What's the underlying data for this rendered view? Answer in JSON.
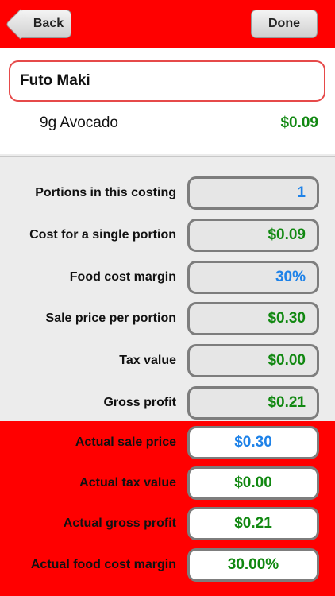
{
  "navbar": {
    "back_label": "Back",
    "done_label": "Done"
  },
  "recipe": {
    "name": "Futo Maki",
    "ingredient": {
      "label": "9g Avocado",
      "cost": "$0.09"
    }
  },
  "calculations": [
    {
      "label": "Portions in this costing",
      "value": "1",
      "color": "#1e82e8"
    },
    {
      "label": "Cost for a single portion",
      "value": "$0.09",
      "color": "#118811"
    },
    {
      "label": "Food cost margin",
      "value": "30%",
      "color": "#1e82e8"
    },
    {
      "label": "Sale price per portion",
      "value": "$0.30",
      "color": "#118811"
    },
    {
      "label": "Tax value",
      "value": "$0.00",
      "color": "#118811"
    },
    {
      "label": "Gross profit",
      "value": "$0.21",
      "color": "#118811"
    }
  ],
  "actuals": [
    {
      "label": "Actual sale price",
      "value": "$0.30",
      "color": "#1e82e8"
    },
    {
      "label": "Actual tax value",
      "value": "$0.00",
      "color": "#118811"
    },
    {
      "label": "Actual gross profit",
      "value": "$0.21",
      "color": "#118811"
    },
    {
      "label": "Actual food cost margin",
      "value": "30.00%",
      "color": "#118811"
    }
  ]
}
